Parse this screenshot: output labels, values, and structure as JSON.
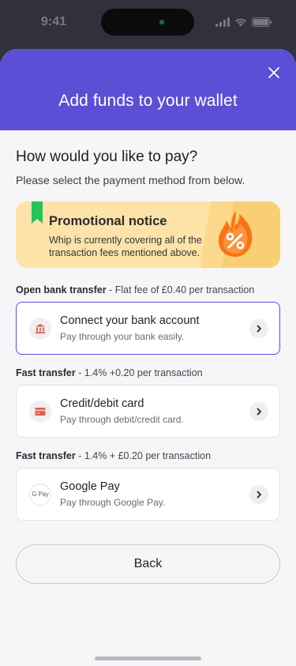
{
  "status_bar": {
    "time": "9:41"
  },
  "header": {
    "title": "Add funds to your wallet"
  },
  "main": {
    "question": "How would you like to pay?",
    "subtitle": "Please select the payment method from below."
  },
  "promo": {
    "title": "Promotional notice",
    "text": "Whip is currently covering all of the transaction fees mentioned above.",
    "badge_icon": "percent-flame-icon"
  },
  "methods": [
    {
      "section_label": "Open bank transfer",
      "fee": "Flat fee of £0.40 per transaction",
      "title": "Connect your bank account",
      "subtitle": "Pay through your bank easily.",
      "icon": "bank-icon",
      "selected": true
    },
    {
      "section_label": "Fast transfer",
      "fee": "1.4% +0.20 per transaction",
      "title": "Credit/debit card",
      "subtitle": "Pay through debit/credit card.",
      "icon": "card-icon",
      "selected": false
    },
    {
      "section_label": "Fast transfer",
      "fee": "1.4% + £0.20 per transaction",
      "title": "Google Pay",
      "subtitle": "Pay through Google Pay.",
      "icon": "google-pay-icon",
      "icon_text": "G Pay",
      "selected": false
    }
  ],
  "back_button": {
    "label": "Back"
  },
  "colors": {
    "accent": "#5b4fd6",
    "promo_bg": "#fde3a7",
    "ribbon": "#22c55e",
    "badge": "#f97316"
  }
}
